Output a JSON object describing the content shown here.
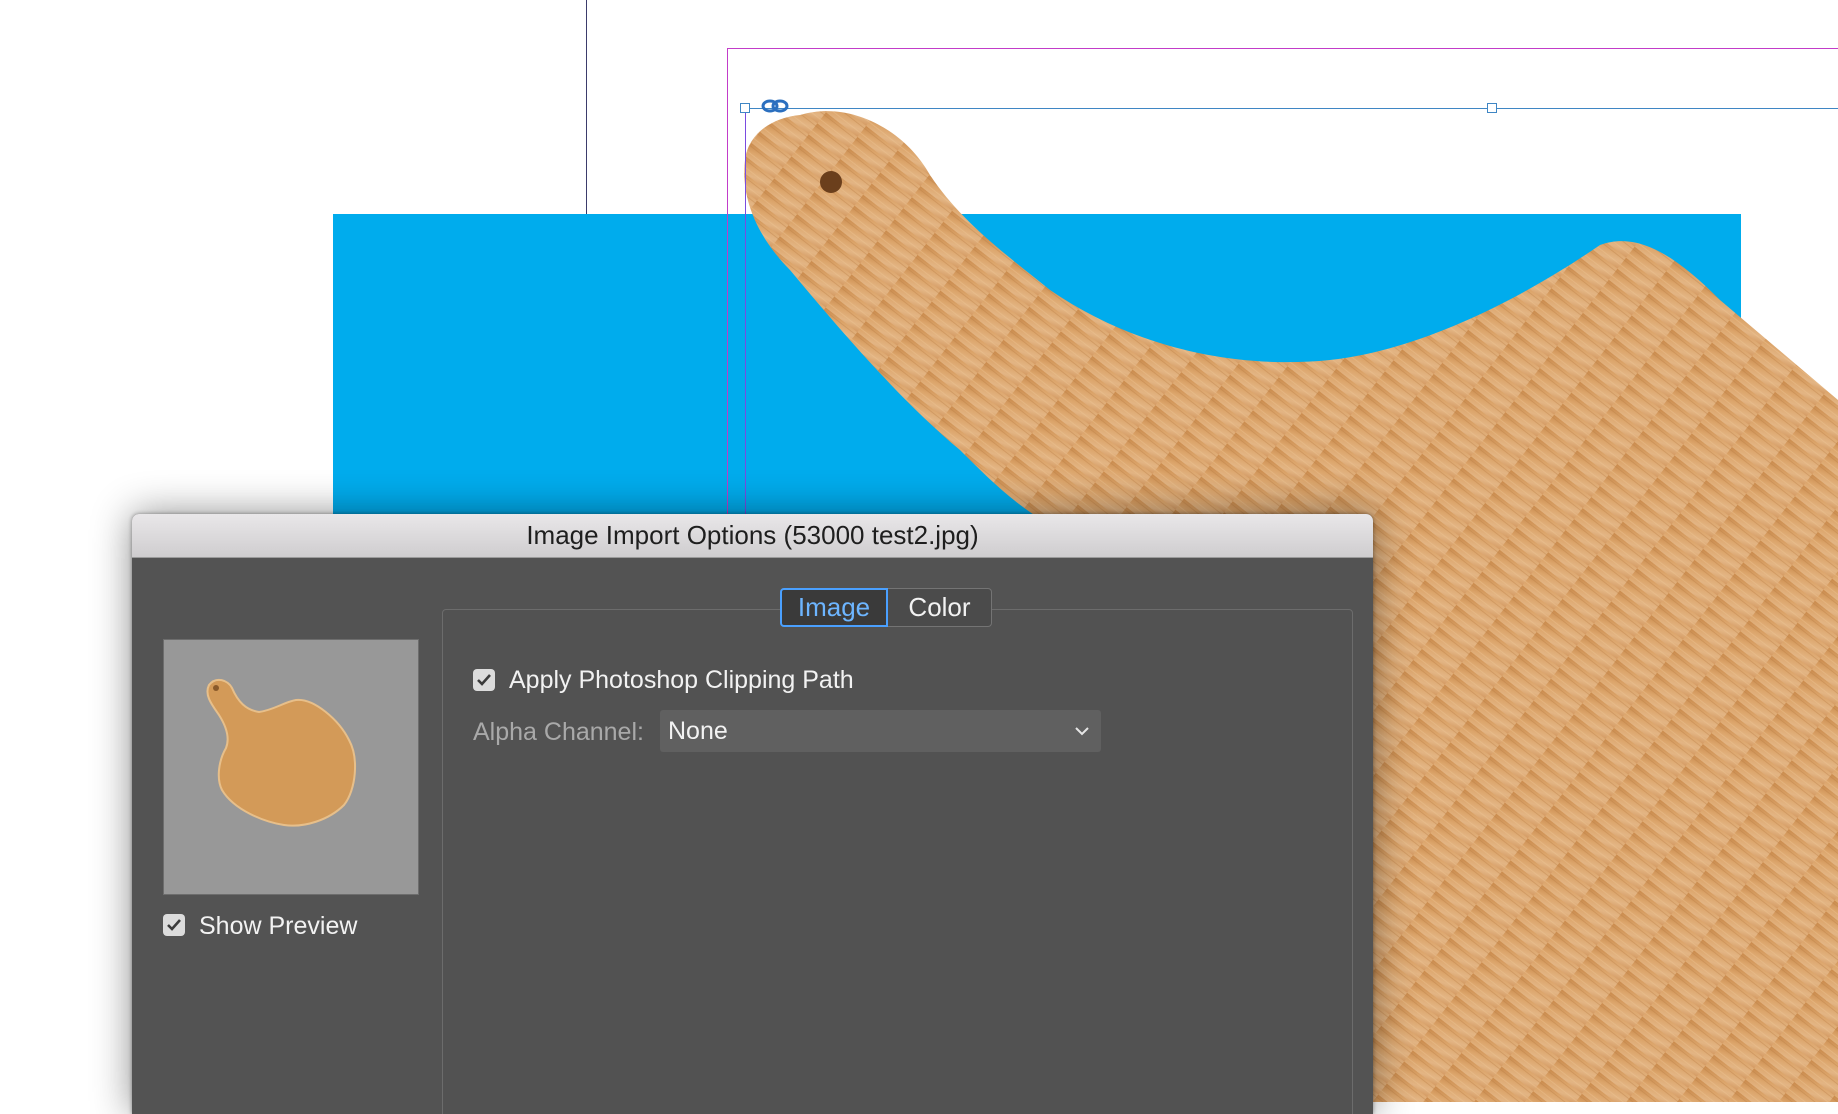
{
  "dialog": {
    "title": "Image Import Options (53000 test2.jpg)",
    "tabs": [
      {
        "label": "Image",
        "selected": true
      },
      {
        "label": "Color",
        "selected": false
      }
    ],
    "apply_clipping_path": {
      "label": "Apply Photoshop Clipping Path",
      "checked": true
    },
    "alpha_channel": {
      "label": "Alpha Channel:",
      "value": "None"
    },
    "show_preview": {
      "label": "Show Preview",
      "checked": true
    }
  },
  "colors": {
    "canvas_blue": "#00aced",
    "dialog_bg": "#535353",
    "active_tab_accent": "#4aa0ff",
    "wood": "#d9a06a"
  },
  "icons": [
    "link-icon",
    "checkmark-icon",
    "chevron-down-icon"
  ]
}
